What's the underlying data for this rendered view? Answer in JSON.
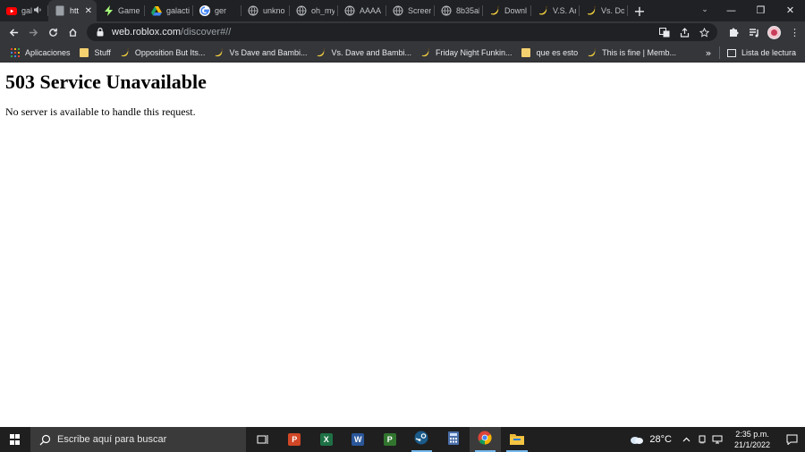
{
  "browser": {
    "tabs": [
      {
        "label": "gal",
        "favicon": "youtube-icon",
        "color": "#ff0000",
        "state": "muted"
      },
      {
        "label": "htt",
        "favicon": "page-icon",
        "color": "#9aa0a6",
        "state": "active"
      },
      {
        "label": "Game",
        "favicon": "lightning-icon",
        "color": "#a6ff7a",
        "state": "normal"
      },
      {
        "label": "galacti",
        "favicon": "drive-icon",
        "color": "#1fa463",
        "state": "normal"
      },
      {
        "label": "ger",
        "favicon": "google-icon",
        "color": "#4285f4",
        "state": "normal"
      },
      {
        "label": "unkno",
        "favicon": "globe-icon",
        "color": "#bdc1c6",
        "state": "normal"
      },
      {
        "label": "oh_my",
        "favicon": "globe-icon",
        "color": "#bdc1c6",
        "state": "normal"
      },
      {
        "label": "AAAA",
        "favicon": "globe-icon",
        "color": "#bdc1c6",
        "state": "normal"
      },
      {
        "label": "Screen",
        "favicon": "globe-icon",
        "color": "#bdc1c6",
        "state": "normal"
      },
      {
        "label": "8b35al",
        "favicon": "globe-icon",
        "color": "#bdc1c6",
        "state": "normal"
      },
      {
        "label": "Downl",
        "favicon": "banana-icon",
        "color": "#f4d03f",
        "state": "normal"
      },
      {
        "label": "V.S. An",
        "favicon": "banana-icon",
        "color": "#f4d03f",
        "state": "normal"
      },
      {
        "label": "Vs. Do",
        "favicon": "banana-icon",
        "color": "#f4d03f",
        "state": "normal"
      }
    ],
    "new_tab": "+",
    "window_controls": {
      "minimize": "—",
      "restore": "❐",
      "close": "✕"
    },
    "address": {
      "host": "web.roblox.com",
      "path": "/discover#//"
    },
    "bookmarks": [
      {
        "label": "Aplicaciones",
        "icon": "apps-grid-icon"
      },
      {
        "label": "Stuff",
        "icon": "folder-icon"
      },
      {
        "label": "Opposition But Its...",
        "icon": "banana-icon"
      },
      {
        "label": "Vs Dave and Bambi...",
        "icon": "banana-icon"
      },
      {
        "label": "Vs. Dave and Bambi...",
        "icon": "banana-icon"
      },
      {
        "label": "Friday Night Funkin...",
        "icon": "banana-icon"
      },
      {
        "label": "que es esto",
        "icon": "folder-icon"
      },
      {
        "label": "This is fine | Memb...",
        "icon": "banana-icon"
      }
    ],
    "bookmarks_overflow": "»",
    "reading_list": "Lista de lectura"
  },
  "page": {
    "heading": "503 Service Unavailable",
    "message": "No server is available to handle this request."
  },
  "taskbar": {
    "search_placeholder": "Escribe aquí para buscar",
    "apps": [
      {
        "name": "task-view",
        "letter": "",
        "color": "#ffffff"
      },
      {
        "name": "powerpoint",
        "letter": "P",
        "color": "#d24726"
      },
      {
        "name": "excel",
        "letter": "X",
        "color": "#1e7145"
      },
      {
        "name": "word",
        "letter": "W",
        "color": "#2b579a"
      },
      {
        "name": "project",
        "letter": "P",
        "color": "#31752f"
      },
      {
        "name": "steam",
        "letter": "",
        "color": "#1b2838"
      },
      {
        "name": "calculator",
        "letter": "",
        "color": "#4a6ea9"
      },
      {
        "name": "chrome",
        "letter": "",
        "color": "#db4437"
      },
      {
        "name": "file-explorer",
        "letter": "",
        "color": "#f4c542"
      }
    ],
    "weather": "28°C",
    "time": "2:35 p.m.",
    "date": "21/1/2022"
  }
}
